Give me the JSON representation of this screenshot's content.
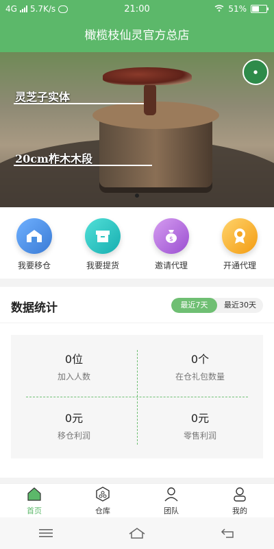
{
  "status_bar": {
    "network": "4G",
    "speed": "5.7K/s",
    "time": "21:00",
    "battery": "51%"
  },
  "header": {
    "title": "橄榄枝仙灵官方总店"
  },
  "banner": {
    "line1": "灵芝子实体",
    "line2": "20cm柞木木段",
    "slide_index": 1,
    "slide_count": 1
  },
  "quick_actions": [
    {
      "label": "我要移仓",
      "icon": "warehouse-icon",
      "color": "#4a90e2"
    },
    {
      "label": "我要提货",
      "icon": "box-icon",
      "color": "#2ec4c0"
    },
    {
      "label": "邀请代理",
      "icon": "money-bag-icon",
      "color": "#b36bdc"
    },
    {
      "label": "开通代理",
      "icon": "medal-icon",
      "color": "#f5a623"
    }
  ],
  "stats": {
    "title": "数据统计",
    "range_options": [
      "最近7天",
      "最近30天"
    ],
    "selected_range": "最近7天",
    "items": [
      {
        "value": "0位",
        "label": "加入人数"
      },
      {
        "value": "0个",
        "label": "在仓礼包数量"
      },
      {
        "value": "0元",
        "label": "移仓利润"
      },
      {
        "value": "0元",
        "label": "零售利润"
      }
    ]
  },
  "tabbar": {
    "items": [
      {
        "label": "首页",
        "icon": "home-icon"
      },
      {
        "label": "仓库",
        "icon": "warehouse-hex-icon"
      },
      {
        "label": "团队",
        "icon": "team-icon"
      },
      {
        "label": "我的",
        "icon": "user-icon"
      }
    ],
    "active": "首页"
  },
  "colors": {
    "brand": "#5cb86a",
    "accent_tab_active": "#6fbf73"
  }
}
